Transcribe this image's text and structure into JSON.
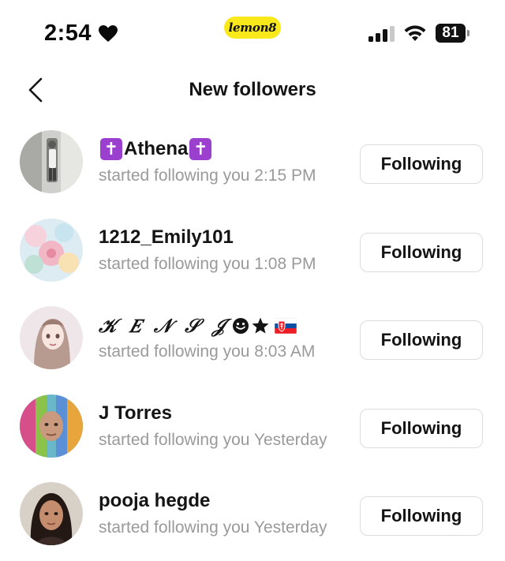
{
  "status_bar": {
    "time": "2:54",
    "app_badge": "lemon8",
    "battery": "81"
  },
  "header": {
    "title": "New followers"
  },
  "followers": [
    {
      "name": "Athena",
      "subtitle": "started following you 2:15 PM",
      "button": "Following"
    },
    {
      "name": "1212_Emily101",
      "subtitle": "started following you 1:08 PM",
      "button": "Following"
    },
    {
      "name": "𝒦 𝐸 𝒩 𝒮 𝒥",
      "subtitle": "started following you 8:03 AM",
      "button": "Following"
    },
    {
      "name": "J Torres",
      "subtitle": "started following you Yesterday",
      "button": "Following"
    },
    {
      "name": "pooja hegde",
      "subtitle": "started following you Yesterday",
      "button": "Following"
    }
  ],
  "colors": {
    "brand_yellow": "#f9e81a",
    "cross_badge": "#9b3fcf",
    "subtitle_gray": "#9a9a9a",
    "button_border": "#dcdcdc"
  },
  "icons": {
    "status": [
      "heart-icon",
      "signal-icon",
      "wifi-icon",
      "battery-icon"
    ],
    "header": [
      "back-chevron-icon"
    ],
    "name_decorations": [
      "cross-icon",
      "smile-icon",
      "star-icon",
      "slovakia-flag-icon"
    ]
  }
}
